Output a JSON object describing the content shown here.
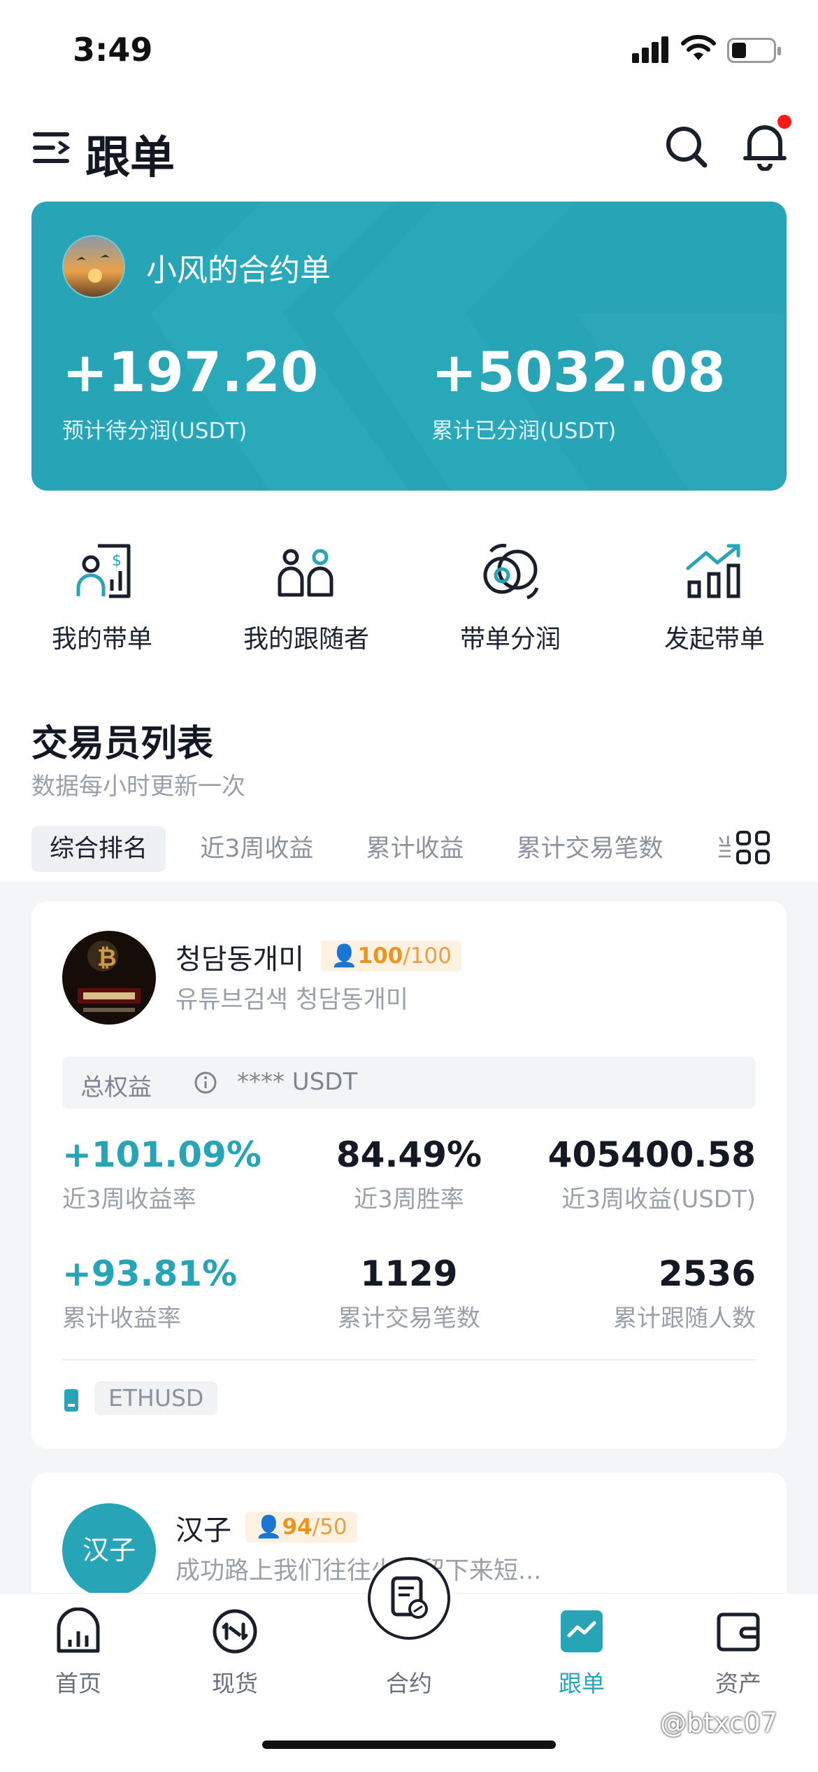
{
  "status_bar": {
    "time": "3:49"
  },
  "header": {
    "title": "跟单"
  },
  "banner": {
    "name": "小风的合约单",
    "stat1": {
      "value": "+197.20",
      "label": "预计待分润(USDT)"
    },
    "stat2": {
      "value": "+5032.08",
      "label": "累计已分润(USDT)"
    }
  },
  "quick_actions": [
    {
      "label": "我的带单",
      "icon": "my-lead-orders-icon"
    },
    {
      "label": "我的跟随者",
      "icon": "my-followers-icon"
    },
    {
      "label": "带单分润",
      "icon": "profit-share-icon"
    },
    {
      "label": "发起带单",
      "icon": "start-lead-icon"
    }
  ],
  "section": {
    "title": "交易员列表",
    "subtitle": "数据每小时更新一次"
  },
  "tabs": [
    "综合排名",
    "近3周收益",
    "累计收益",
    "累计交易笔数",
    "当"
  ],
  "traders": [
    {
      "name": "청담동개미",
      "score": "100",
      "score_max": "/100",
      "desc": "유튜브검색 청담동개미",
      "equity_label": "总权益",
      "equity_value": "**** USDT",
      "stats": [
        {
          "value": "+101.09%",
          "label": "近3周收益率"
        },
        {
          "value": "84.49%",
          "label": "近3周胜率"
        },
        {
          "value": "405400.58",
          "label": "近3周收益(USDT)"
        },
        {
          "value": "+93.81%",
          "label": "累计收益率"
        },
        {
          "value": "1129",
          "label": "累计交易笔数"
        },
        {
          "value": "2536",
          "label": "累计跟随人数"
        }
      ],
      "pair": "ETHUSD"
    },
    {
      "name": "汉子",
      "avatar_text": "汉子",
      "score": "94",
      "score_max": "/50",
      "desc": "成功路上我们往往少停留下来短..."
    }
  ],
  "bottom_nav": [
    {
      "label": "首页",
      "icon": "home-chart-icon"
    },
    {
      "label": "现货",
      "icon": "spot-icon"
    },
    {
      "label": "合约",
      "icon": "contract-icon"
    },
    {
      "label": "跟单",
      "icon": "copy-trade-icon",
      "active": true
    },
    {
      "label": "资产",
      "icon": "wallet-icon"
    }
  ],
  "watermark": "@btxc07",
  "colors": {
    "accent": "#27a4b6",
    "badge": "#e8961f",
    "notify": "#ff1a1a"
  }
}
